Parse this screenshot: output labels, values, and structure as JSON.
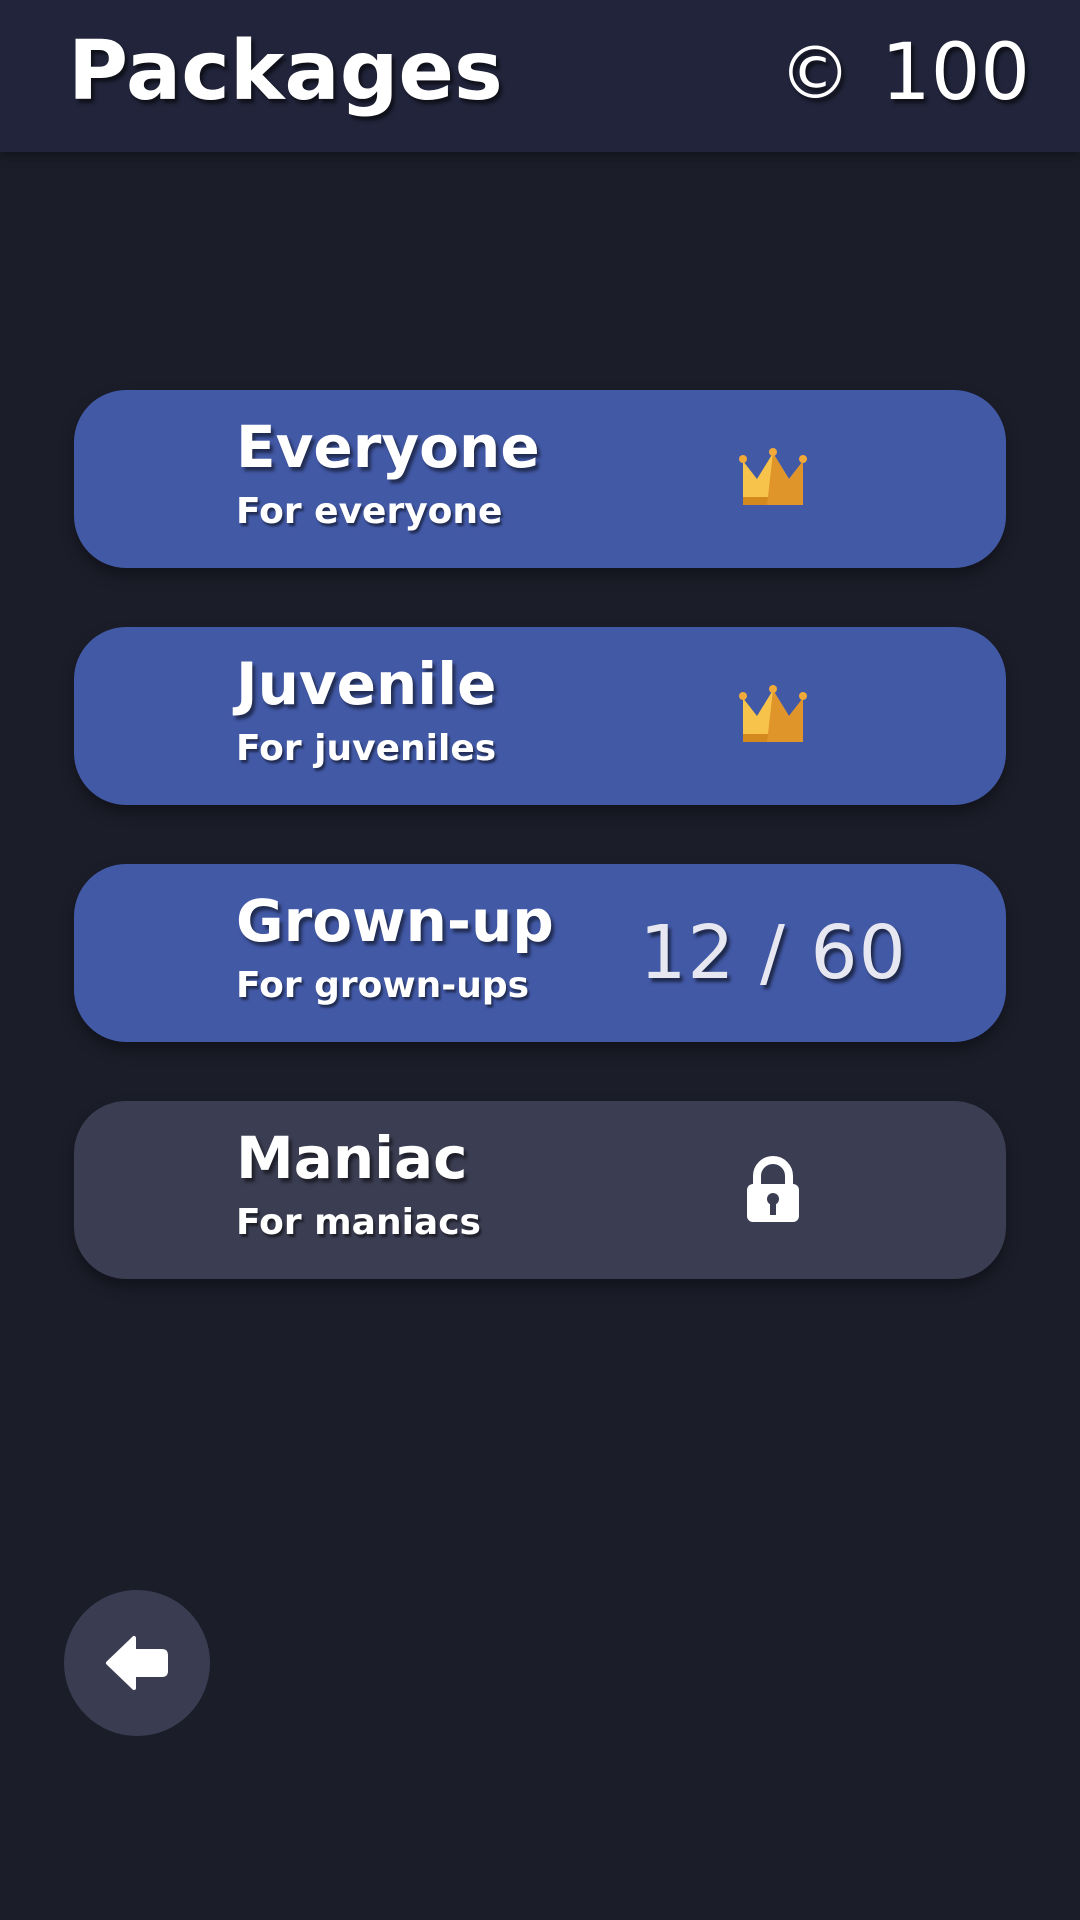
{
  "header": {
    "title": "Packages",
    "coin_symbol": "©",
    "coins": "100"
  },
  "packages": [
    {
      "name": "Everyone",
      "description": "For everyone",
      "status": "completed",
      "icon": "crown-icon"
    },
    {
      "name": "Juvenile",
      "description": "For juveniles",
      "status": "completed",
      "icon": "crown-icon"
    },
    {
      "name": "Grown-up",
      "description": "For grown-ups",
      "status": "in-progress",
      "progress": "12 / 60"
    },
    {
      "name": "Maniac",
      "description": "For maniacs",
      "status": "locked",
      "icon": "lock-icon"
    }
  ],
  "footer": {
    "back_icon": "back-arrow-icon"
  },
  "colors": {
    "background": "#1b1d29",
    "header": "#21243a",
    "pack_active": "#4259a6",
    "pack_locked": "#3b3d52",
    "crown": "#f5b635"
  }
}
